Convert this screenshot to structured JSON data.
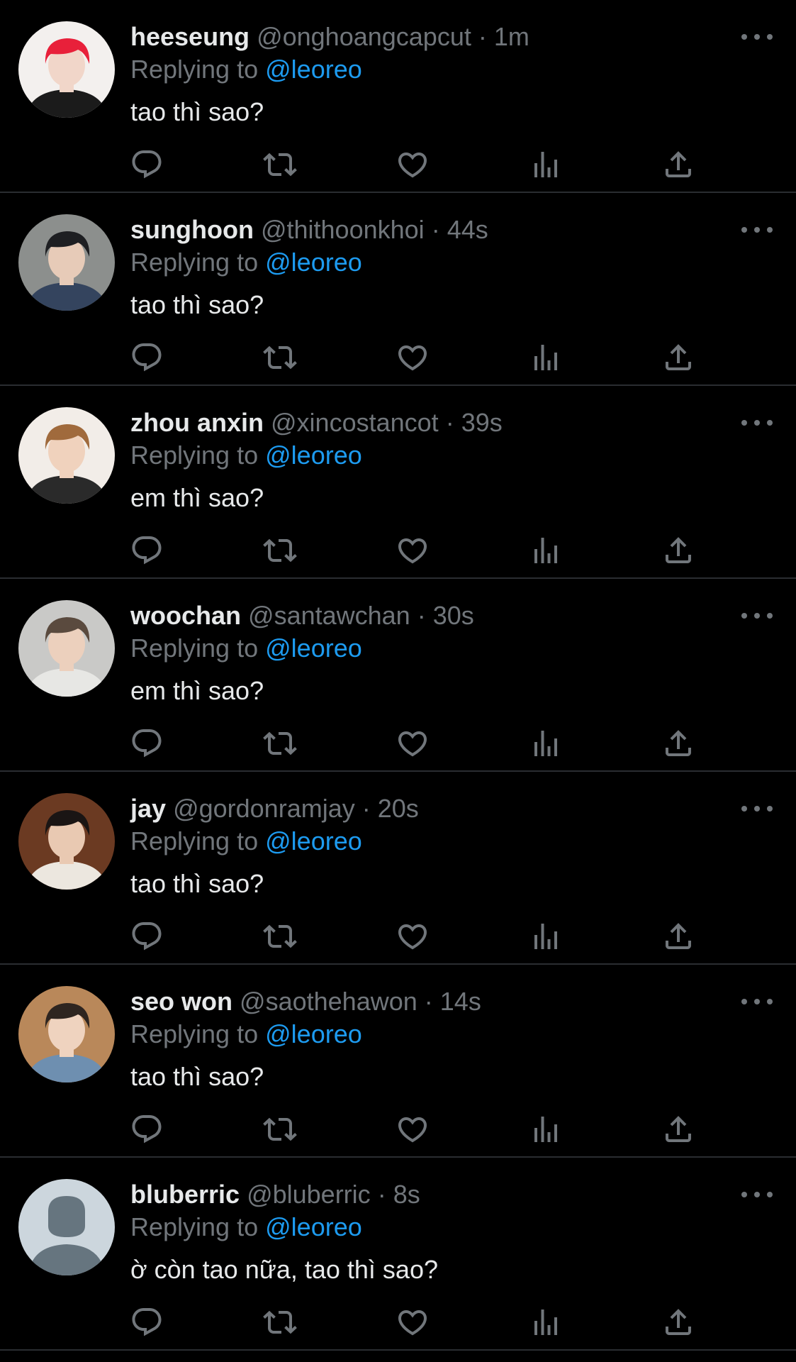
{
  "feed": {
    "replying_label": "Replying to",
    "tweets": [
      {
        "display_name": "heeseung",
        "handle": "@onghoangcapcut",
        "time": "1m",
        "replying_to": "@leoreo",
        "text": "tao thì sao?",
        "avatar": {
          "background": "#f3f0ee",
          "hair": "#e8203a",
          "skin": "#f1d6c9",
          "shirt": "#1b1b1b"
        }
      },
      {
        "display_name": "sunghoon",
        "handle": "@thithoonkhoi",
        "time": "44s",
        "replying_to": "@leoreo",
        "text": "tao thì sao?",
        "avatar": {
          "background": "#8c8f8d",
          "hair": "#1e1f22",
          "skin": "#e7cbb8",
          "shirt": "#34445e"
        }
      },
      {
        "display_name": "zhou anxin",
        "handle": "@xincostancot",
        "time": "39s",
        "replying_to": "@leoreo",
        "text": "em thì sao?",
        "avatar": {
          "background": "#f2ede8",
          "hair": "#a06a3c",
          "skin": "#f0d2bd",
          "shirt": "#2a2a2a"
        }
      },
      {
        "display_name": "woochan",
        "handle": "@santawchan",
        "time": "30s",
        "replying_to": "@leoreo",
        "text": "em thì sao?",
        "avatar": {
          "background": "#c9c9c7",
          "hair": "#5a4a3e",
          "skin": "#ecd0bd",
          "shirt": "#e7e7e4"
        }
      },
      {
        "display_name": "jay",
        "handle": "@gordonramjay",
        "time": "20s",
        "replying_to": "@leoreo",
        "text": "tao thì sao?",
        "avatar": {
          "background": "#6b3a22",
          "hair": "#1a1514",
          "skin": "#e9c9b2",
          "shirt": "#ece7df"
        }
      },
      {
        "display_name": "seo won",
        "handle": "@saothehawon",
        "time": "14s",
        "replying_to": "@leoreo",
        "text": "tao thì sao?",
        "avatar": {
          "background": "#b9885a",
          "hair": "#2e2520",
          "skin": "#efd3bf",
          "shirt": "#6e8fb0"
        }
      },
      {
        "display_name": "bluberric",
        "handle": "@bluberric",
        "time": "8s",
        "replying_to": "@leoreo",
        "text": "ờ còn tao nữa, tao thì sao?",
        "avatar": {
          "background": "#ccd6dd",
          "hair": "#66757f",
          "skin": "#66757f",
          "shirt": "#66757f"
        }
      }
    ]
  },
  "icons": {
    "reply": "reply-icon",
    "retweet": "retweet-icon",
    "like": "like-icon",
    "views": "views-icon",
    "share": "share-icon",
    "more": "more-icon"
  },
  "colors": {
    "background": "#000000",
    "text_primary": "#e7e9ea",
    "text_secondary": "#71767b",
    "mention": "#1d9bf0",
    "divider": "#2a2d31"
  }
}
